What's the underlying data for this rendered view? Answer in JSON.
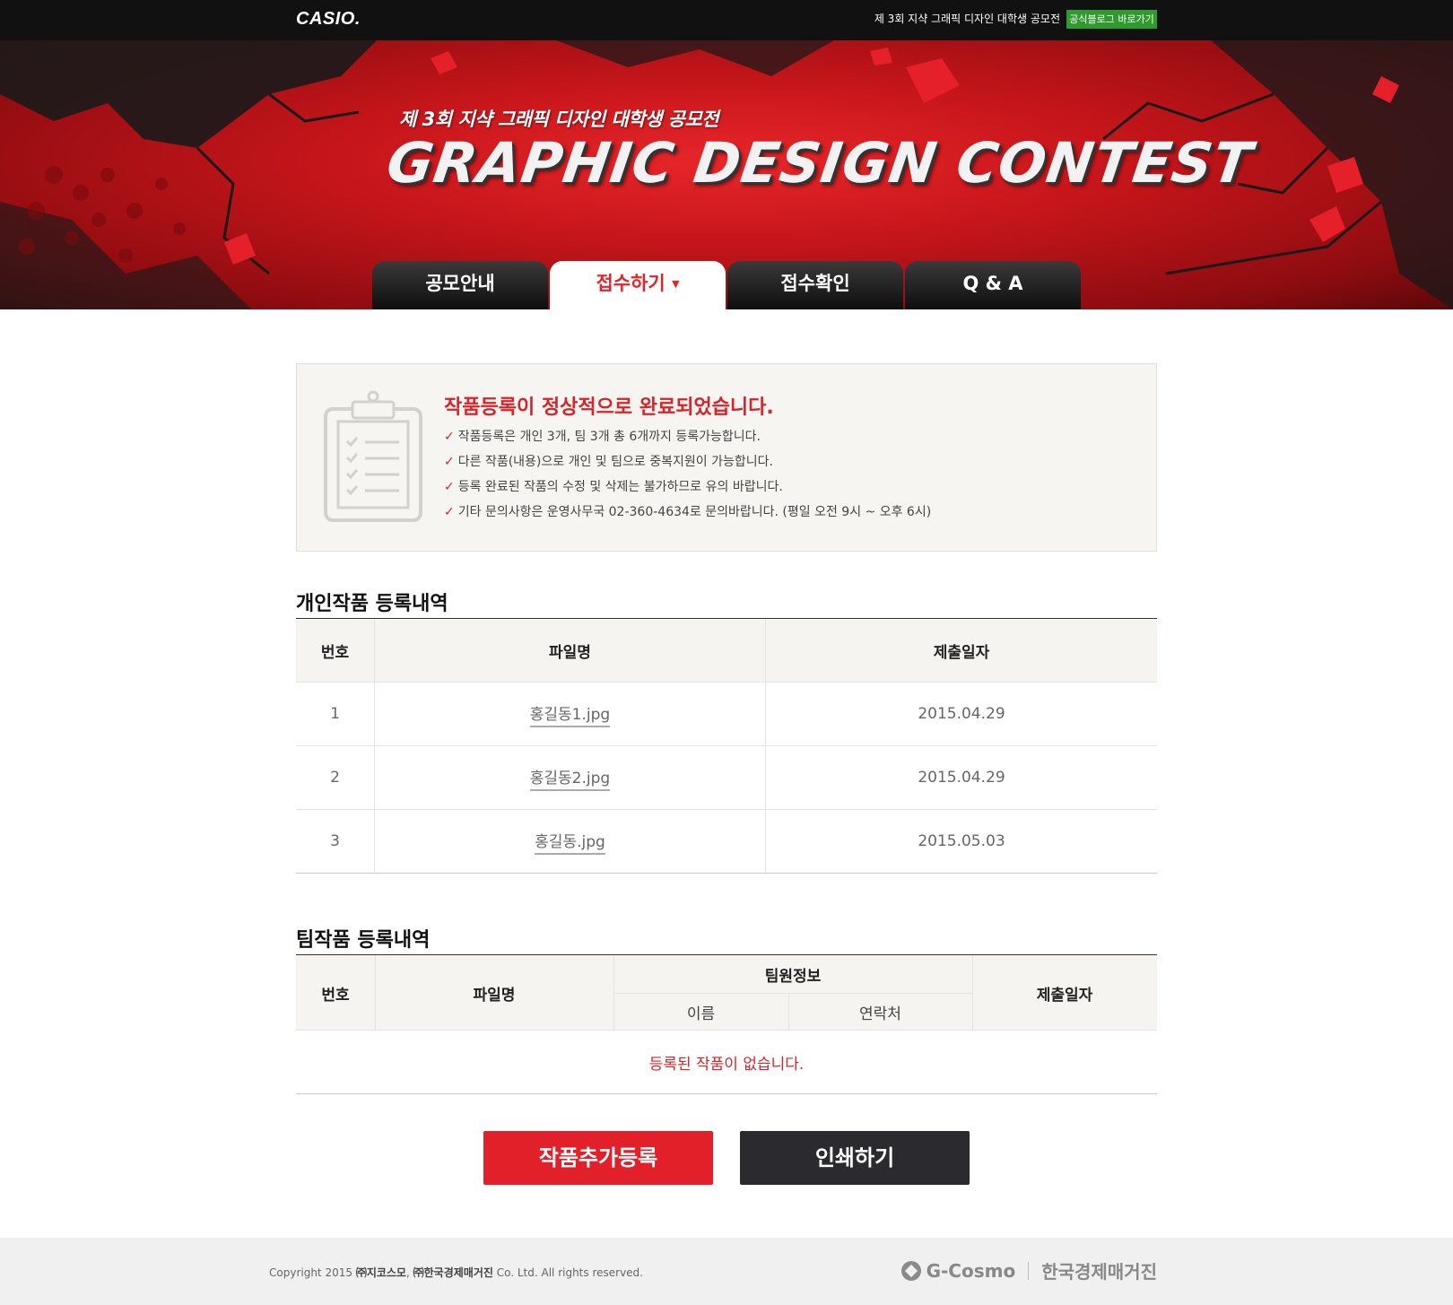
{
  "topbar": {
    "logo": "CASIO.",
    "title": "제 3회 지샥 그래픽 디자인 대학생 공모전",
    "blog_button": "공식블로그 바로가기"
  },
  "hero": {
    "subtitle": "제 3회 지샥 그래픽 디자인 대학생 공모전",
    "title": "GRAPHIC DESIGN CONTEST"
  },
  "tabs": [
    {
      "label": "공모안내",
      "active": false
    },
    {
      "label": "접수하기",
      "active": true,
      "caret": "▼"
    },
    {
      "label": "접수확인",
      "active": false
    },
    {
      "label": "Q & A",
      "active": false
    }
  ],
  "notice": {
    "icon": "clipboard-checklist-icon",
    "title": "작품등록이 정상적으로 완료되었습니다.",
    "check_mark": "✓",
    "items": [
      "작품등록은 개인 3개, 팀 3개 총 6개까지 등록가능합니다.",
      "다른 작품(내용)으로 개인 및 팀으로 중복지원이 가능합니다.",
      "등록 완료된 작품의 수정 및 삭제는 불가하므로 유의 바랍니다.",
      "기타 문의사항은 운영사무국 02-360-4634로 문의바랍니다. (평일 오전 9시 ~ 오후 6시)"
    ]
  },
  "individual": {
    "title": "개인작품 등록내역",
    "headers": [
      "번호",
      "파일명",
      "제출일자"
    ],
    "rows": [
      {
        "no": "1",
        "file": "홍길동1.jpg",
        "date": "2015.04.29"
      },
      {
        "no": "2",
        "file": "홍길동2.jpg",
        "date": "2015.04.29"
      },
      {
        "no": "3",
        "file": "홍길동.jpg",
        "date": "2015.05.03"
      }
    ]
  },
  "team": {
    "title": "팀작품 등록내역",
    "headers": {
      "no": "번호",
      "file": "파일명",
      "members": "팀원정보",
      "name": "이름",
      "contact": "연락처",
      "date": "제출일자"
    },
    "empty_message": "등록된 작품이 없습니다."
  },
  "buttons": {
    "add": "작품추가등록",
    "print": "인쇄하기"
  },
  "footer": {
    "copyright_prefix": "Copyright 2015 ",
    "company1": "㈜지코스모",
    "comma": ", ",
    "company2": "㈜한국경제매거진",
    "copyright_suffix": " Co. Ltd. All rights reserved.",
    "logo1": "G-Cosmo",
    "logo2": "한국경제매거진"
  },
  "colors": {
    "accent_red": "#e2202a",
    "dark_button": "#2b2b2f",
    "blog_green": "#2e9b2c"
  }
}
